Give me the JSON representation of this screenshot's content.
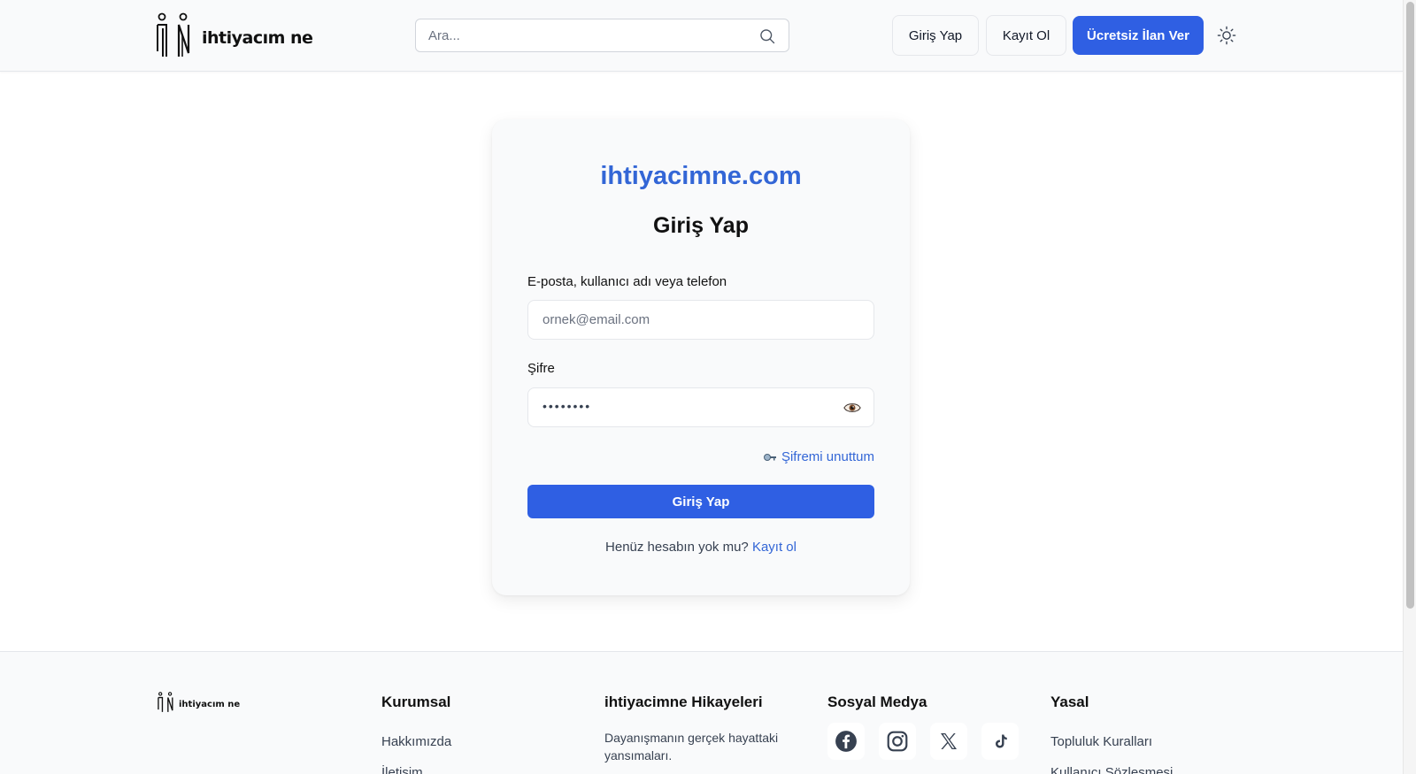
{
  "header": {
    "logo_text": "ihtiyacım ne",
    "search_placeholder": "Ara...",
    "login_label": "Giriş Yap",
    "register_label": "Kayıt Ol",
    "post_ad_label": "Ücretsiz İlan Ver"
  },
  "login_card": {
    "brand": "ihtiyacimne.com",
    "title": "Giriş Yap",
    "identifier_label": "E-posta, kullanıcı adı veya telefon",
    "identifier_placeholder": "ornek@email.com",
    "password_label": "Şifre",
    "password_mask": "••••••••",
    "forgot_password": "Şifremi unuttum",
    "submit_label": "Giriş Yap",
    "no_account_text": "Henüz hesabın yok mu?",
    "register_link": "Kayıt ol"
  },
  "footer": {
    "logo_text": "ihtiyacım ne",
    "kurumsal": {
      "title": "Kurumsal",
      "links": [
        "Hakkımızda",
        "İletişim"
      ]
    },
    "stories": {
      "title": "ihtiyacimne Hikayeleri",
      "description": "Dayanışmanın gerçek hayattaki yansımaları."
    },
    "social": {
      "title": "Sosyal Medya",
      "icons": [
        "facebook-icon",
        "instagram-icon",
        "x-icon",
        "tiktok-icon"
      ]
    },
    "legal": {
      "title": "Yasal",
      "links": [
        "Topluluk Kuralları",
        "Kullanıcı Sözleşmesi"
      ]
    }
  },
  "colors": {
    "accent": "#2f5fe3",
    "brand_text": "#3366d6",
    "surface": "#f9fafb"
  }
}
